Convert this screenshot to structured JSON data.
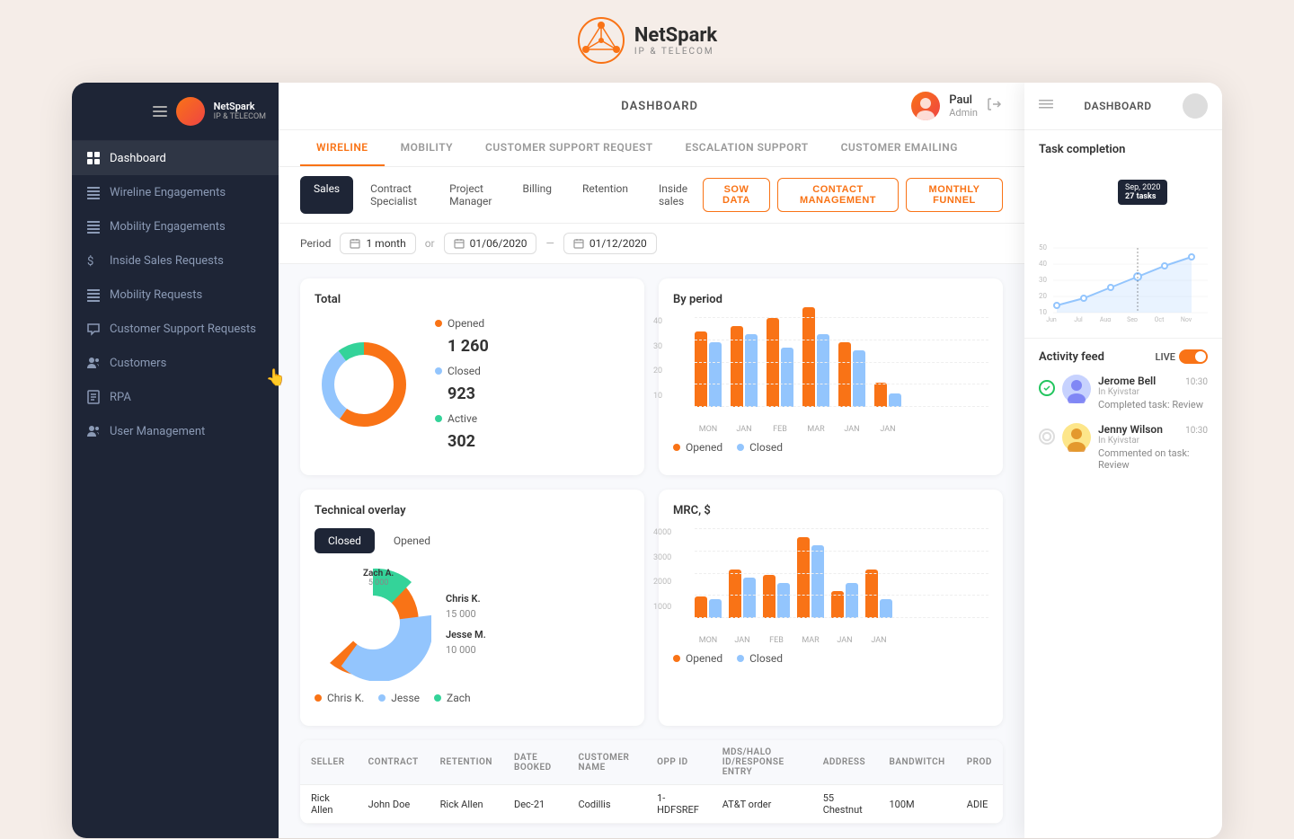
{
  "app": {
    "name": "NetSpark",
    "subtitle": "IP & TELECOM",
    "title": "DASHBOARD"
  },
  "user": {
    "name": "Paul",
    "role": "Admin",
    "avatar_bg": "#f97316"
  },
  "sidebar": {
    "items": [
      {
        "id": "dashboard",
        "label": "Dashboard",
        "icon": "grid",
        "active": true
      },
      {
        "id": "wireline-engagements",
        "label": "Wireline Engagements",
        "icon": "table",
        "active": false
      },
      {
        "id": "mobility-engagements",
        "label": "Mobility Engagements",
        "icon": "table",
        "active": false
      },
      {
        "id": "inside-sales",
        "label": "Inside Sales Requests",
        "icon": "dollar",
        "active": false
      },
      {
        "id": "mobility-requests",
        "label": "Mobility Requests",
        "icon": "table",
        "active": false
      },
      {
        "id": "customer-support",
        "label": "Customer Support Requests",
        "icon": "message",
        "active": false
      },
      {
        "id": "customers",
        "label": "Customers",
        "icon": "users",
        "active": false
      },
      {
        "id": "rpa",
        "label": "RPA",
        "icon": "book",
        "active": false
      },
      {
        "id": "user-management",
        "label": "User Management",
        "icon": "users",
        "active": false
      }
    ]
  },
  "tabs": {
    "main": [
      {
        "id": "wireline",
        "label": "WIRELINE",
        "active": true
      },
      {
        "id": "mobility",
        "label": "MOBILITY",
        "active": false
      },
      {
        "id": "customer-support",
        "label": "CUSTOMER SUPPORT REQUEST",
        "active": false
      },
      {
        "id": "escalation",
        "label": "ESCALATION SUPPORT",
        "active": false
      },
      {
        "id": "emailing",
        "label": "CUSTOMER EMAILING",
        "active": false
      }
    ],
    "sub": [
      {
        "id": "sales",
        "label": "Sales",
        "active": true
      },
      {
        "id": "contract",
        "label": "Contract Specialist",
        "active": false
      },
      {
        "id": "project",
        "label": "Project Manager",
        "active": false
      },
      {
        "id": "billing",
        "label": "Billing",
        "active": false
      },
      {
        "id": "retention",
        "label": "Retention",
        "active": false
      },
      {
        "id": "inside",
        "label": "Inside sales",
        "active": false
      }
    ]
  },
  "action_buttons": [
    {
      "id": "sow-data",
      "label": "SOW DATA"
    },
    {
      "id": "contact-management",
      "label": "CONTACT MANAGEMENT"
    },
    {
      "id": "monthly-funnel",
      "label": "MONTHLY FUNNEL"
    }
  ],
  "period": {
    "label": "Period",
    "preset": "1 month",
    "start": "01/06/2020",
    "end": "01/12/2020"
  },
  "total_chart": {
    "title": "Total",
    "opened": {
      "label": "Opened",
      "value": "1 260",
      "color": "#f97316"
    },
    "closed": {
      "label": "Closed",
      "value": "923",
      "color": "#93c5fd"
    },
    "active": {
      "label": "Active",
      "value": "302",
      "color": "#34d399"
    }
  },
  "by_period_chart": {
    "title": "By period",
    "y_max": 40,
    "labels": [
      "MON",
      "JAN",
      "FEB",
      "MAR",
      "JAN",
      "JAN"
    ],
    "opened": [
      28,
      30,
      33,
      37,
      24,
      9
    ],
    "closed": [
      24,
      27,
      22,
      27,
      21,
      5
    ],
    "legend": [
      {
        "label": "Opened",
        "color": "#f97316"
      },
      {
        "label": "Closed",
        "color": "#93c5fd"
      }
    ]
  },
  "technical_overlay": {
    "title": "Technical overlay",
    "tabs": [
      "Closed",
      "Opened"
    ],
    "active_tab": "Closed",
    "segments": [
      {
        "name": "Chris K.",
        "value": "15 000",
        "color": "#f97316",
        "pct": 60
      },
      {
        "name": "Jesse M.",
        "value": "10 000",
        "color": "#93c5fd",
        "pct": 25
      },
      {
        "name": "Zach A.",
        "value": "5 000",
        "color": "#34d399",
        "pct": 15
      }
    ],
    "legend": [
      {
        "label": "Chris K.",
        "color": "#f97316"
      },
      {
        "label": "Jesse",
        "color": "#93c5fd"
      },
      {
        "label": "Zach",
        "color": "#34d399"
      }
    ]
  },
  "mrc_chart": {
    "title": "MRC, $",
    "y_labels": [
      "4000",
      "3000",
      "2000",
      "1000"
    ],
    "labels": [
      "MON",
      "JAN",
      "FEB",
      "MAR",
      "JAN",
      "JAN"
    ],
    "opened": [
      800,
      1800,
      1600,
      3000,
      1000,
      1800
    ],
    "closed": [
      700,
      1500,
      1300,
      2700,
      1300,
      700
    ],
    "legend": [
      {
        "label": "Opened",
        "color": "#f97316"
      },
      {
        "label": "Closed",
        "color": "#93c5fd"
      }
    ]
  },
  "table": {
    "headers": [
      "SELLER",
      "CONTRACT",
      "RETENTION",
      "DATE BOOKED",
      "CUSTOMER NAME",
      "OPP ID",
      "MDS/HALO ID/RESPONSE ENTRY",
      "ADDRESS",
      "BANDWITCH",
      "PROD"
    ],
    "rows": [
      [
        "Rick Allen",
        "John Doe",
        "Rick Allen",
        "Dec-21",
        "Codillis",
        "1-HDFSREF",
        "AT&T order",
        "55 Chestnut",
        "100M",
        "ADIE"
      ]
    ]
  },
  "right_panel": {
    "title": "DASHBOARD",
    "task_completion": {
      "title": "Task completion",
      "y_labels": [
        "50",
        "40",
        "30",
        "20",
        "10"
      ],
      "x_labels": [
        "Jun",
        "Jul",
        "Aug",
        "Sep",
        "Oct",
        "Nov"
      ],
      "values": [
        18,
        22,
        27,
        33,
        38,
        42
      ],
      "tooltip": {
        "month": "Sep, 2020",
        "value": "27 tasks"
      }
    },
    "activity_feed": {
      "title": "Activity feed",
      "live": true,
      "items": [
        {
          "type": "check",
          "name": "Jerome Bell",
          "location": "In Kyivstar",
          "description": "Completed task: Review",
          "time": "10:30"
        },
        {
          "type": "comment",
          "name": "Jenny Wilson",
          "location": "In Kyivstar",
          "description": "Commented on task: Review",
          "time": "10:30"
        }
      ]
    }
  }
}
